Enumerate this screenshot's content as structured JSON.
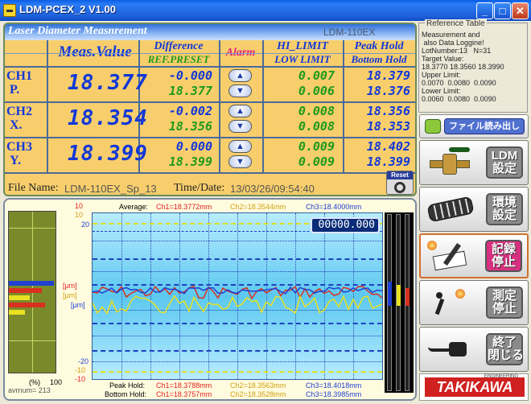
{
  "window": {
    "title": "LDM-PCEX_2 V1.00"
  },
  "panel": {
    "title": "Laser Diameter Measnrement",
    "model": "LDM-110EX"
  },
  "columns": {
    "meas": "Meas.Value",
    "difference": "Difference",
    "ref_preset": "REF.PRESET",
    "alarm": "Alarm",
    "hi_limit": "HI_LIMIT",
    "low_limit": "LOW LIMIT",
    "peak_hold": "Peak Hold",
    "bottom_hold": "Bottom Hold"
  },
  "channels": [
    {
      "ch": "CH1",
      "axis": "P.",
      "meas": "18.377",
      "diff": "-0.000",
      "ref": "18.377",
      "hi": "0.007",
      "low": "0.006",
      "peak": "18.379",
      "bottom": "18.376"
    },
    {
      "ch": "CH2",
      "axis": "X.",
      "meas": "18.354",
      "diff": "-0.002",
      "ref": "18.356",
      "hi": "0.008",
      "low": "0.008",
      "peak": "18.356",
      "bottom": "18.353"
    },
    {
      "ch": "CH3",
      "axis": "Y.",
      "meas": "18.399",
      "diff": "0.000",
      "ref": "18.399",
      "hi": "0.009",
      "low": "0.009",
      "peak": "18.402",
      "bottom": "18.399"
    }
  ],
  "file": {
    "label": "File Name:",
    "name": "LDM-110EX_Sp_13",
    "date_label": "Time/Date:",
    "date": "13/03/26/09:54:40",
    "reset": "Reset"
  },
  "chart": {
    "average_label": "Average:",
    "avg1": "Ch1=18.3772mm",
    "avg2": "Ch2=18.3544mm",
    "avg3": "Ch3=18.4000mm",
    "peak_label": "Peak Hold:",
    "peak1": "Ch1=18.3788mm",
    "peak2": "Ch2=18.3563mm",
    "peak3": "Ch3=18.4018mm",
    "bottom_label": "Bottom Hold:",
    "bottom1": "Ch1=18.3757mm",
    "bottom2": "Ch2=18.3528mm",
    "bottom3": "Ch3=18.3985mm",
    "counter": "00000.000",
    "y_top_red": "10",
    "y_top_yel": "10",
    "y_top_blu": "20",
    "y_bot_blu": "-20",
    "y_bot_yel": "-10",
    "y_bot_red": "-10",
    "unit": "[μm]",
    "pct": "(%)",
    "pct_max": "100",
    "avrnum": "avrnum= 213",
    "mini_bars": [
      0.97,
      0.7,
      0.45,
      0.78,
      0.35
    ]
  },
  "reference": {
    "title": "Reference Table",
    "text": "Measurement and\n also Data Loggine!\nLotNumber:13   N=31\nTarget Value:\n18.3770 18.3560 18.3990\nUpper Limit:\n0.0070  0.0080  0.0090\nLower Limit:\n0.0060  0.0080  0.0090"
  },
  "buttons": {
    "file_read": "ファイル読み出し",
    "ldm_setting": "LDM\n設定",
    "env_setting": "環境\n設定",
    "record_stop": "記録\n停止",
    "measure_stop": "測定\n停止",
    "exit": "終了\n閉じる",
    "logo": "TAKIKAWA",
    "logo_sub": "ENGINEERING"
  },
  "colors": {
    "ch1": "#E02020",
    "ch2": "#D0A010",
    "ch3": "#2040D0",
    "panel": "#F8CE6C"
  }
}
